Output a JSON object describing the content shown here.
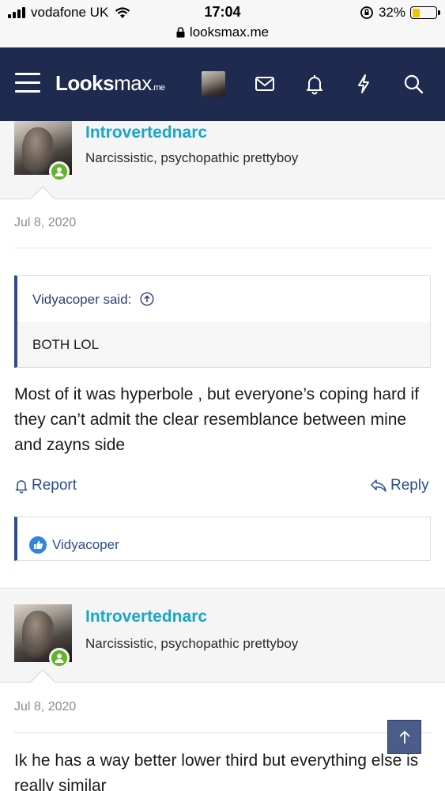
{
  "status_bar": {
    "carrier": "vodafone UK",
    "time": "17:04",
    "battery_percent": "32%",
    "url": "looksmax.me"
  },
  "header": {
    "logo": {
      "part1": "L",
      "part2": "ooks",
      "part3": "max",
      "tld": ".me"
    },
    "icons": [
      "menu-icon",
      "avatar",
      "mail-icon",
      "bell-icon",
      "bolt-icon",
      "search-icon"
    ],
    "colors": {
      "background": "#1e2a4e",
      "accent": "#19a6c9"
    }
  },
  "posts": [
    {
      "username": "Introvertednarc",
      "user_title": "Narcissistic, psychopathic prettyboy",
      "date": "Jul 8, 2020",
      "quote": {
        "author_line": "Vidyacoper said:",
        "text": "BOTH LOL"
      },
      "text": "Most of it was hyperbole , but everyone’s coping hard if they can’t admit the clear resemblance between mine and zayns side",
      "report_label": "Report",
      "reply_label": "Reply",
      "reaction_user": "Vidyacoper"
    },
    {
      "username": "Introvertednarc",
      "user_title": "Narcissistic, psychopathic prettyboy",
      "date": "Jul 8, 2020",
      "text": "Ik he has a way better lower third but everything else is really similar"
    }
  ]
}
